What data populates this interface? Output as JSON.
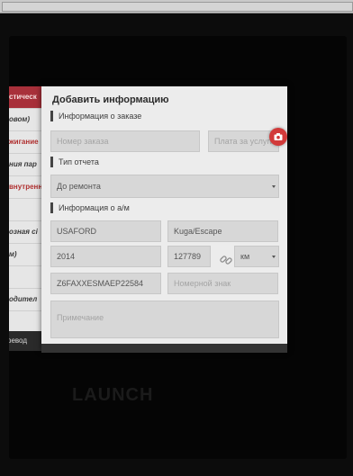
{
  "left_panel": {
    "rows": [
      {
        "text": "стическ",
        "style": "header"
      },
      {
        "text": "овом)",
        "style": "bold"
      },
      {
        "text": "жигание",
        "style": "red"
      },
      {
        "text": "ния пар",
        "style": "bold"
      },
      {
        "text": "внутренн",
        "style": "red"
      },
      {
        "text": "",
        "style": "plain"
      },
      {
        "text": "озная сі",
        "style": "bold"
      },
      {
        "text": "м)",
        "style": "bold"
      },
      {
        "text": "",
        "style": "plain"
      },
      {
        "text": "одител",
        "style": "bold"
      },
      {
        "text": "",
        "style": "plain"
      }
    ],
    "bottom_label": "ревод"
  },
  "dialog": {
    "title": "Добавить информацию",
    "order_section": "Информация о заказе",
    "order_number_placeholder": "Номер заказа",
    "service_fee_placeholder": "Плата за услуги",
    "report_section": "Тип отчета",
    "report_type_value": "До ремонта",
    "vehicle_section": "Информация о а/м",
    "make_value": "USAFORD",
    "model_value": "Kuga/Escape",
    "year_value": "2014",
    "mileage_value": "127789",
    "unit_value": "км",
    "vin_value": "Z6FAXXESMAEP22584",
    "plate_placeholder": "Номерной знак",
    "note_placeholder": "Примечание"
  },
  "brand": "LAUNCH",
  "colors": {
    "accent": "#d23a3a",
    "dialog_bg": "#ececec",
    "field_bg": "#d7d7d7"
  }
}
